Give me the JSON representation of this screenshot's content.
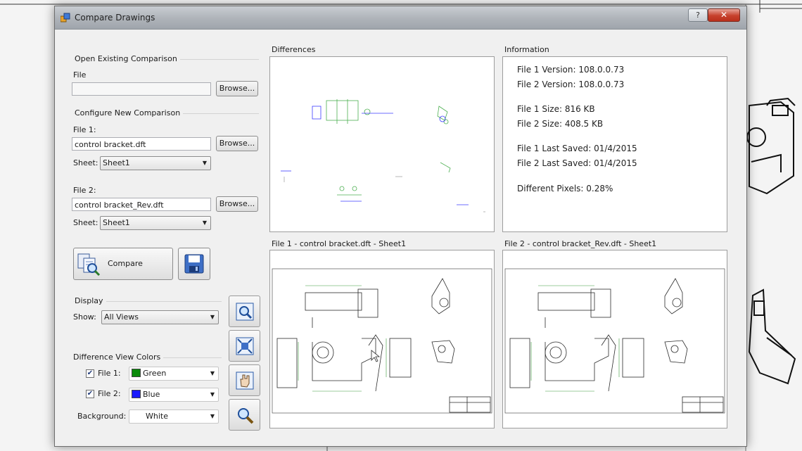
{
  "window": {
    "title": "Compare Drawings",
    "help_label": "?",
    "close_label": "✕"
  },
  "open_existing": {
    "group_title": "Open Existing Comparison",
    "file_label": "File",
    "file_value": "",
    "browse_label": "Browse..."
  },
  "configure_new": {
    "group_title": "Configure New Comparison",
    "file1_label": "File 1:",
    "file1_value": "control bracket.dft",
    "file1_browse": "Browse...",
    "sheet1_label": "Sheet:",
    "sheet1_value": "Sheet1",
    "file2_label": "File 2:",
    "file2_value": "control bracket_Rev.dft",
    "file2_browse": "Browse...",
    "sheet2_label": "Sheet:",
    "sheet2_value": "Sheet1"
  },
  "compare_button": {
    "label": "Compare"
  },
  "display": {
    "group_title": "Display",
    "show_label": "Show:",
    "show_value": "All Views"
  },
  "colors": {
    "group_title": "Difference View Colors",
    "file1_label": "File 1:",
    "file1_checked": true,
    "file1_color_name": "Green",
    "file1_color": "#0a8a0a",
    "file2_label": "File 2:",
    "file2_checked": true,
    "file2_color_name": "Blue",
    "file2_color": "#1a1aff",
    "background_label": "Background:",
    "background_value": "White"
  },
  "panels": {
    "differences_title": "Differences",
    "information_title": "Information",
    "file1_view_title": "File 1 - control bracket.dft - Sheet1",
    "file2_view_title": "File 2 - control bracket_Rev.dft - Sheet1"
  },
  "information": {
    "file1_version": "File 1 Version: 108.0.0.73",
    "file2_version": "File 2 Version: 108.0.0.73",
    "file1_size": "File 1 Size: 816 KB",
    "file2_size": "File 2 Size: 408.5 KB",
    "file1_saved": "File 1 Last Saved: 01/4/2015",
    "file2_saved": "File 2 Last Saved: 01/4/2015",
    "different_pixels": "Different Pixels: 0.28%"
  },
  "icons": [
    "app-icon",
    "compare-icon",
    "save-icon",
    "zoom-area-icon",
    "fit-icon",
    "pan-icon",
    "zoom-icon"
  ]
}
